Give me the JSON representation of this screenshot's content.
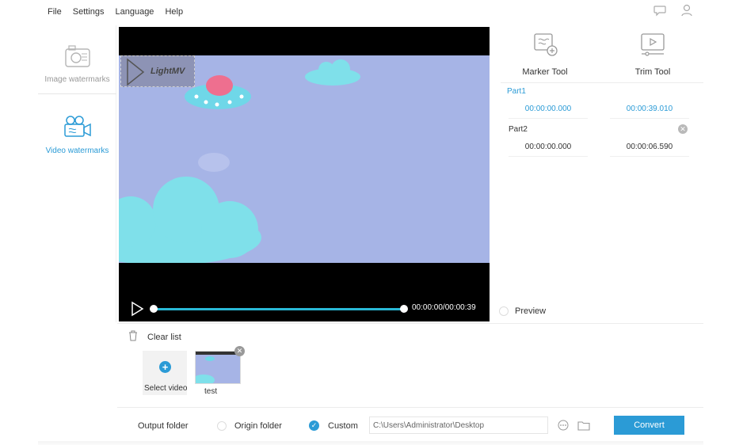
{
  "menu": {
    "items": [
      "File",
      "Settings",
      "Language",
      "Help"
    ]
  },
  "top_icons": [
    "chat-icon",
    "user-icon"
  ],
  "sidebar": {
    "tabs": [
      {
        "label": "Image watermarks",
        "icon": "image-icon",
        "active": false
      },
      {
        "label": "Video watermarks",
        "icon": "video-camera-icon",
        "active": true
      }
    ]
  },
  "player": {
    "watermark_text": "LightMV",
    "time_display": "00:00:00/00:00:39",
    "progress": 1.0
  },
  "tools": {
    "marker_label": "Marker Tool",
    "trim_label": "Trim Tool"
  },
  "parts": [
    {
      "label": "Part1",
      "start": "00:00:00.000",
      "end": "00:00:39.010"
    },
    {
      "label": "Part2",
      "start": "00:00:00.000",
      "end": "00:00:06.590"
    }
  ],
  "preview_label": "Preview",
  "file_list": {
    "clear_label": "Clear list",
    "select_video_label": "Select video",
    "files": [
      {
        "name": "test"
      }
    ]
  },
  "output": {
    "output_folder_label": "Output folder",
    "origin_label": "Origin folder",
    "custom_label": "Custom",
    "path": "C:\\Users\\Administrator\\Desktop",
    "selected": "Custom",
    "convert_label": "Convert"
  },
  "colors": {
    "accent": "#2b9bd6",
    "video_bg": "#a6b4e6",
    "progress": "#29b8d6"
  }
}
